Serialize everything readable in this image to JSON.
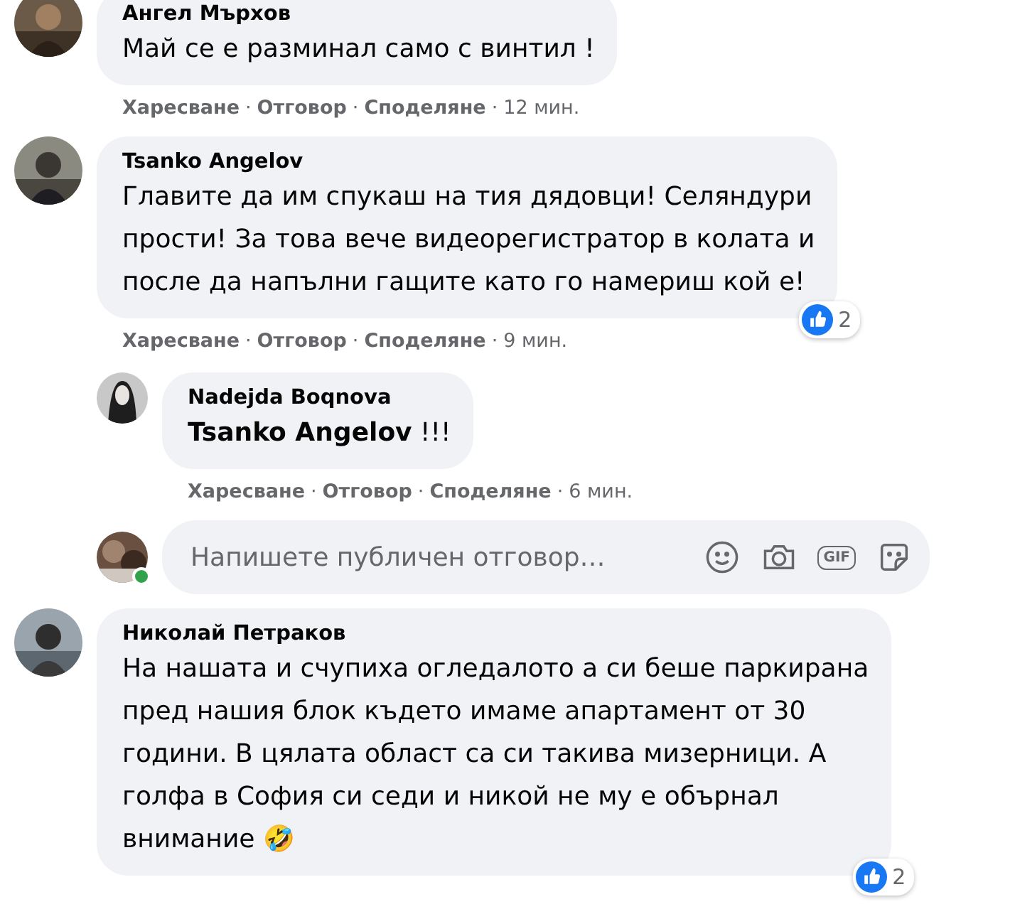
{
  "comments": [
    {
      "author": "Ангел Мърхов",
      "lines": [
        "Май се е разминал само с винтил !"
      ],
      "actions": [
        {
          "label": "Харесване",
          "separator": "·"
        },
        {
          "label": "Отговор",
          "separator": "·"
        },
        {
          "label": "Споделяне",
          "separator": "·"
        }
      ],
      "time": "12 мин."
    },
    {
      "author": "Tsanko Angelov",
      "lines": [
        "Главите да им спукаш на тия дядовци! Селяндури",
        "прости! За това вече видеорегистратор в колата и",
        "после да напълни гащите като го намериш кой е!"
      ],
      "actions": [
        {
          "label": "Харесване",
          "separator": "·"
        },
        {
          "label": "Отговор",
          "separator": "·"
        },
        {
          "label": "Споделяне",
          "separator": "·"
        }
      ],
      "time": "9 мин.",
      "reactions": {
        "count": "2"
      },
      "replies": [
        {
          "author": "Nadejda Boqnova",
          "lines": [
            "**Tsanko Angelov** !!!"
          ],
          "actions": [
            {
              "label": "Харесване",
              "separator": "·"
            },
            {
              "label": "Отговор",
              "separator": "·"
            },
            {
              "label": "Споделяне",
              "separator": "·"
            }
          ],
          "time": "6 мин."
        }
      ],
      "reply_box": {
        "placeholder": "Напишете публичен отговор…",
        "online": true,
        "gif_label": "GIF"
      }
    },
    {
      "author": "Николай Петраков",
      "lines": [
        "На нашата и счупиха огледалото а си беше паркирана",
        "пред нашия блок където имаме апартамент от 30",
        "години. В цялата област са си такива мизерници. А",
        "голфа в София си седи и никой не му е обърнал",
        "внимание 🤣"
      ],
      "reactions": {
        "count": "2"
      }
    }
  ]
}
